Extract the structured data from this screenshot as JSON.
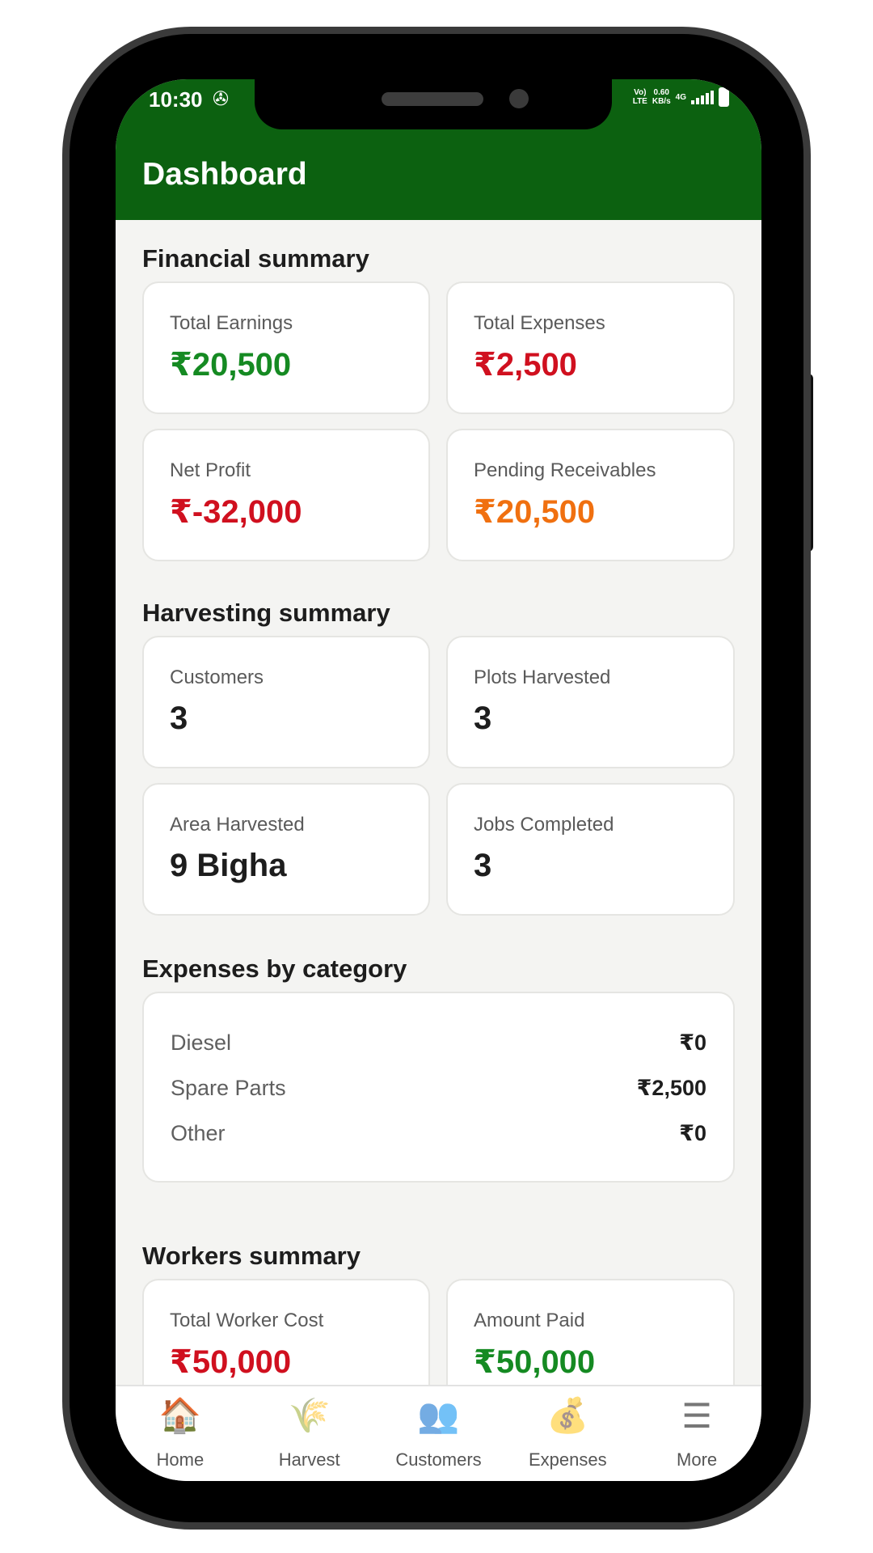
{
  "status_bar": {
    "time": "10:30",
    "network_top": "Vo)",
    "network_bottom": "LTE",
    "speed_top": "0.60",
    "speed_bottom": "KB/s",
    "signal_type": "4G"
  },
  "header": {
    "title": "Dashboard"
  },
  "financial": {
    "title": "Financial summary",
    "cards": [
      {
        "label": "Total Earnings",
        "value": "₹20,500",
        "color": "#158a22"
      },
      {
        "label": "Total Expenses",
        "value": "₹2,500",
        "color": "#d0101f"
      },
      {
        "label": "Net Profit",
        "value": "₹-32,000",
        "color": "#d0101f"
      },
      {
        "label": "Pending Receivables",
        "value": "₹20,500",
        "color": "#f07010"
      }
    ]
  },
  "harvesting": {
    "title": "Harvesting summary",
    "cards": [
      {
        "label": "Customers",
        "value": "3"
      },
      {
        "label": "Plots Harvested",
        "value": "3"
      },
      {
        "label": "Area Harvested",
        "value": "9 Bigha"
      },
      {
        "label": "Jobs Completed",
        "value": "3"
      }
    ]
  },
  "expenses": {
    "title": "Expenses by category",
    "rows": [
      {
        "name": "Diesel",
        "amount": "₹0"
      },
      {
        "name": "Spare Parts",
        "amount": "₹2,500"
      },
      {
        "name": "Other",
        "amount": "₹0"
      }
    ]
  },
  "workers": {
    "title": "Workers summary",
    "cards": [
      {
        "label": "Total Worker Cost",
        "value": "₹50,000",
        "color": "#d0101f"
      },
      {
        "label": "Amount Paid",
        "value": "₹50,000",
        "color": "#158a22"
      }
    ]
  },
  "nav": [
    {
      "icon": "home-icon",
      "glyph": "🏠",
      "label": "Home"
    },
    {
      "icon": "harvest-icon",
      "glyph": "🌾",
      "label": "Harvest"
    },
    {
      "icon": "customers-icon",
      "glyph": "👥",
      "label": "Customers"
    },
    {
      "icon": "expenses-icon",
      "glyph": "💰",
      "label": "Expenses"
    },
    {
      "icon": "more-icon",
      "glyph": "☰",
      "label": "More"
    }
  ],
  "colors": {
    "primary": "#0c6110",
    "positive": "#158a22",
    "negative": "#d0101f",
    "pending": "#f07010"
  }
}
